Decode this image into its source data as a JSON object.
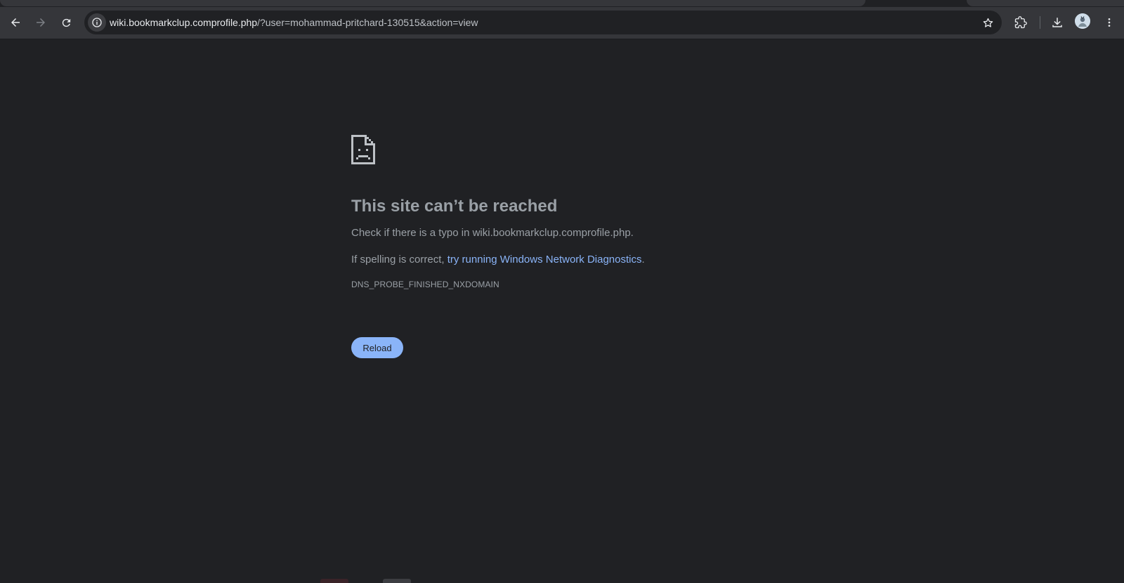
{
  "browser": {
    "url_host": "wiki.bookmarkclup.comprofile.php",
    "url_rest": "/?user=mohammad-pritchard-130515&action=view",
    "icons": [
      "back-arrow-icon",
      "forward-arrow-icon",
      "reload-icon",
      "info-icon",
      "star-icon",
      "extensions-icon",
      "download-icon",
      "profile-avatar",
      "more-vert-icon"
    ]
  },
  "error_page": {
    "icon": "sad-document-icon",
    "headline": "This site can’t be reached",
    "check_text": "Check if there is a typo in wiki.bookmarkclup.comprofile.php.",
    "spelling_prefix": "If spelling is correct, ",
    "diagnostics_link": "try running Windows Network Diagnostics",
    "spelling_suffix": ".",
    "error_code": "DNS_PROBE_FINISHED_NXDOMAIN",
    "reload_label": "Reload"
  },
  "colors": {
    "page_bg": "#202124",
    "toolbar_bg": "#35363a",
    "link": "#8ab4f8",
    "button_bg": "#8ab4f8",
    "text_muted": "#9aa0a6"
  }
}
